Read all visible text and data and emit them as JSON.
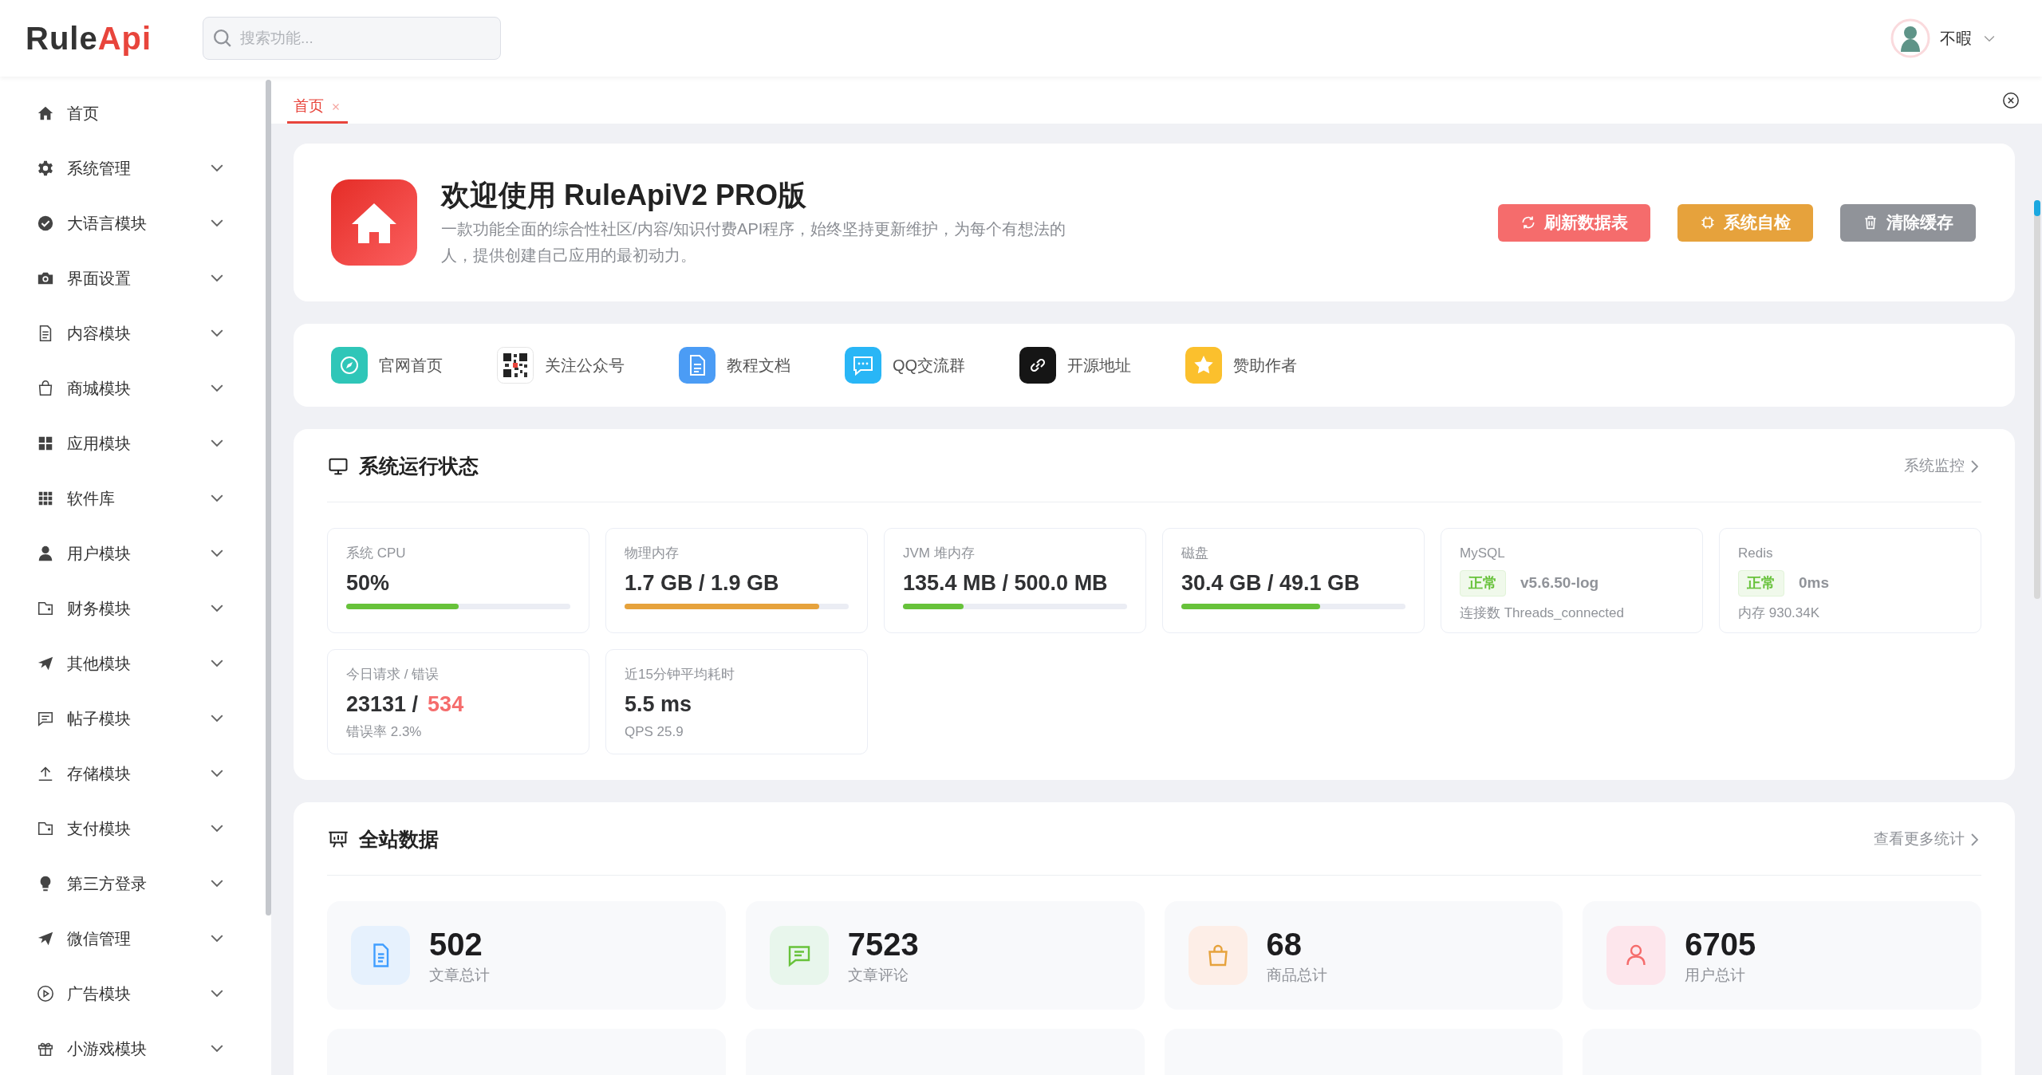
{
  "header": {
    "logo_main": "Rule",
    "logo_accent": "Api",
    "search": {
      "placeholder": "搜索功能..."
    },
    "user": {
      "name": "不暇"
    }
  },
  "sidebar": {
    "items": [
      {
        "label": "首页",
        "has_submenu": false
      },
      {
        "label": "系统管理",
        "has_submenu": true
      },
      {
        "label": "大语言模块",
        "has_submenu": true
      },
      {
        "label": "界面设置",
        "has_submenu": true
      },
      {
        "label": "内容模块",
        "has_submenu": true
      },
      {
        "label": "商城模块",
        "has_submenu": true
      },
      {
        "label": "应用模块",
        "has_submenu": true
      },
      {
        "label": "软件库",
        "has_submenu": true
      },
      {
        "label": "用户模块",
        "has_submenu": true
      },
      {
        "label": "财务模块",
        "has_submenu": true
      },
      {
        "label": "其他模块",
        "has_submenu": true
      },
      {
        "label": "帖子模块",
        "has_submenu": true
      },
      {
        "label": "存储模块",
        "has_submenu": true
      },
      {
        "label": "支付模块",
        "has_submenu": true
      },
      {
        "label": "第三方登录",
        "has_submenu": true
      },
      {
        "label": "微信管理",
        "has_submenu": true
      },
      {
        "label": "广告模块",
        "has_submenu": true
      },
      {
        "label": "小游戏模块",
        "has_submenu": true
      }
    ]
  },
  "tabs": [
    {
      "label": "首页",
      "selected": true
    }
  ],
  "welcome": {
    "title": "欢迎使用 RuleApiV2 PRO版",
    "description": "一款功能全面的综合性社区/内容/知识付费API程序，始终坚持更新维护，为每个有想法的人，提供创建自己应用的最初动力。",
    "buttons": [
      {
        "label": "刷新数据表",
        "kind": "danger"
      },
      {
        "label": "系统自检",
        "kind": "warning"
      },
      {
        "label": "清除缓存",
        "kind": "info"
      }
    ]
  },
  "links": [
    {
      "label": "官网首页"
    },
    {
      "label": "关注公众号"
    },
    {
      "label": "教程文档"
    },
    {
      "label": "QQ交流群"
    },
    {
      "label": "开源地址"
    },
    {
      "label": "赞助作者"
    }
  ],
  "status": {
    "title": "系统运行状态",
    "link": "系统监控",
    "metrics": [
      {
        "kind": "meter",
        "label": "系统 CPU",
        "value": "50%",
        "level": 0.5
      },
      {
        "kind": "meter",
        "label": "物理内存",
        "value": "1.7 GB / 1.9 GB",
        "level": 0.87
      },
      {
        "kind": "meter",
        "label": "JVM 堆内存",
        "value": "135.4 MB / 500.0 MB",
        "level": 0.27
      },
      {
        "kind": "meter",
        "label": "磁盘",
        "value": "30.4 GB / 49.1 GB",
        "level": 0.62
      },
      {
        "kind": "service",
        "label": "MySQL",
        "status": "正常",
        "detail": "v5.6.50-log",
        "note": "连接数 Threads_connected"
      },
      {
        "kind": "service",
        "label": "Redis",
        "status": "正常",
        "detail": "0ms",
        "note": "内存 930.34K"
      },
      {
        "kind": "requests",
        "label": "今日请求 / 错误",
        "value": "23131 /",
        "errors": "534",
        "note": "错误率 2.3%"
      },
      {
        "kind": "plain",
        "label": "近15分钟平均耗时",
        "value": "5.5 ms",
        "note": "QPS 25.9"
      }
    ]
  },
  "site_data": {
    "title": "全站数据",
    "link": "查看更多统计",
    "stats": [
      {
        "value": "502",
        "label": "文章总计"
      },
      {
        "value": "7523",
        "label": "文章评论"
      },
      {
        "value": "68",
        "label": "商品总计"
      },
      {
        "value": "6705",
        "label": "用户总计"
      }
    ]
  }
}
